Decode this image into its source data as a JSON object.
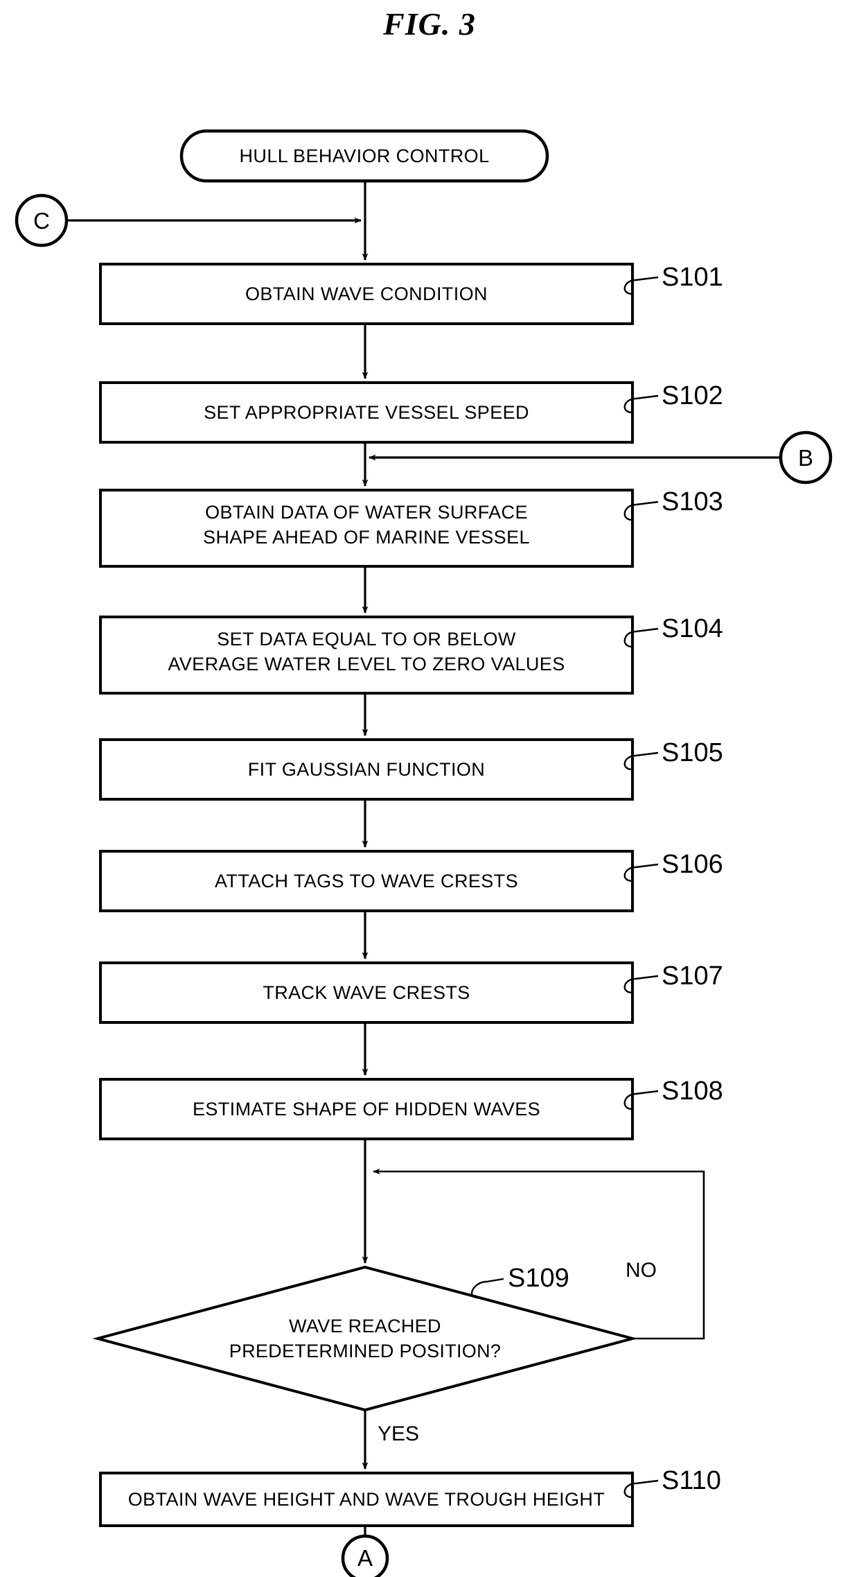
{
  "figure": {
    "title": "FIG. 3",
    "type": "patent-flowchart"
  },
  "start_terminal": {
    "label": "HULL BEHAVIOR CONTROL"
  },
  "connectors": {
    "c": "C",
    "b": "B",
    "a": "A"
  },
  "steps": [
    {
      "id": "S101",
      "label": "OBTAIN WAVE CONDITION",
      "lines": [
        "OBTAIN WAVE CONDITION"
      ]
    },
    {
      "id": "S102",
      "label": "SET APPROPRIATE VESSEL SPEED",
      "lines": [
        "SET APPROPRIATE VESSEL SPEED"
      ]
    },
    {
      "id": "S103",
      "label": "OBTAIN DATA OF WATER SURFACE SHAPE AHEAD OF MARINE VESSEL",
      "lines": [
        "OBTAIN DATA OF WATER SURFACE",
        "SHAPE AHEAD OF MARINE VESSEL"
      ]
    },
    {
      "id": "S104",
      "label": "SET DATA EQUAL TO OR BELOW AVERAGE WATER LEVEL TO ZERO VALUES",
      "lines": [
        "SET DATA EQUAL TO OR BELOW",
        "AVERAGE WATER LEVEL TO ZERO VALUES"
      ]
    },
    {
      "id": "S105",
      "label": "FIT GAUSSIAN FUNCTION",
      "lines": [
        "FIT GAUSSIAN FUNCTION"
      ]
    },
    {
      "id": "S106",
      "label": "ATTACH TAGS TO WAVE CRESTS",
      "lines": [
        "ATTACH TAGS TO WAVE CRESTS"
      ]
    },
    {
      "id": "S107",
      "label": "TRACK WAVE CRESTS",
      "lines": [
        "TRACK WAVE CRESTS"
      ]
    },
    {
      "id": "S108",
      "label": "ESTIMATE SHAPE OF HIDDEN WAVES",
      "lines": [
        "ESTIMATE SHAPE OF HIDDEN WAVES"
      ]
    }
  ],
  "decision": {
    "id": "S109",
    "lines": [
      "WAVE REACHED",
      "PREDETERMINED POSITION?"
    ],
    "label": "WAVE REACHED PREDETERMINED POSITION?",
    "yes_label": "YES",
    "no_label": "NO"
  },
  "final_step": {
    "id": "S110",
    "label": "OBTAIN WAVE HEIGHT AND WAVE TROUGH HEIGHT",
    "lines": [
      "OBTAIN WAVE HEIGHT AND WAVE TROUGH HEIGHT"
    ]
  },
  "colors": {
    "stroke": "#000000",
    "fill": "#ffffff",
    "background": "#ffffff"
  }
}
